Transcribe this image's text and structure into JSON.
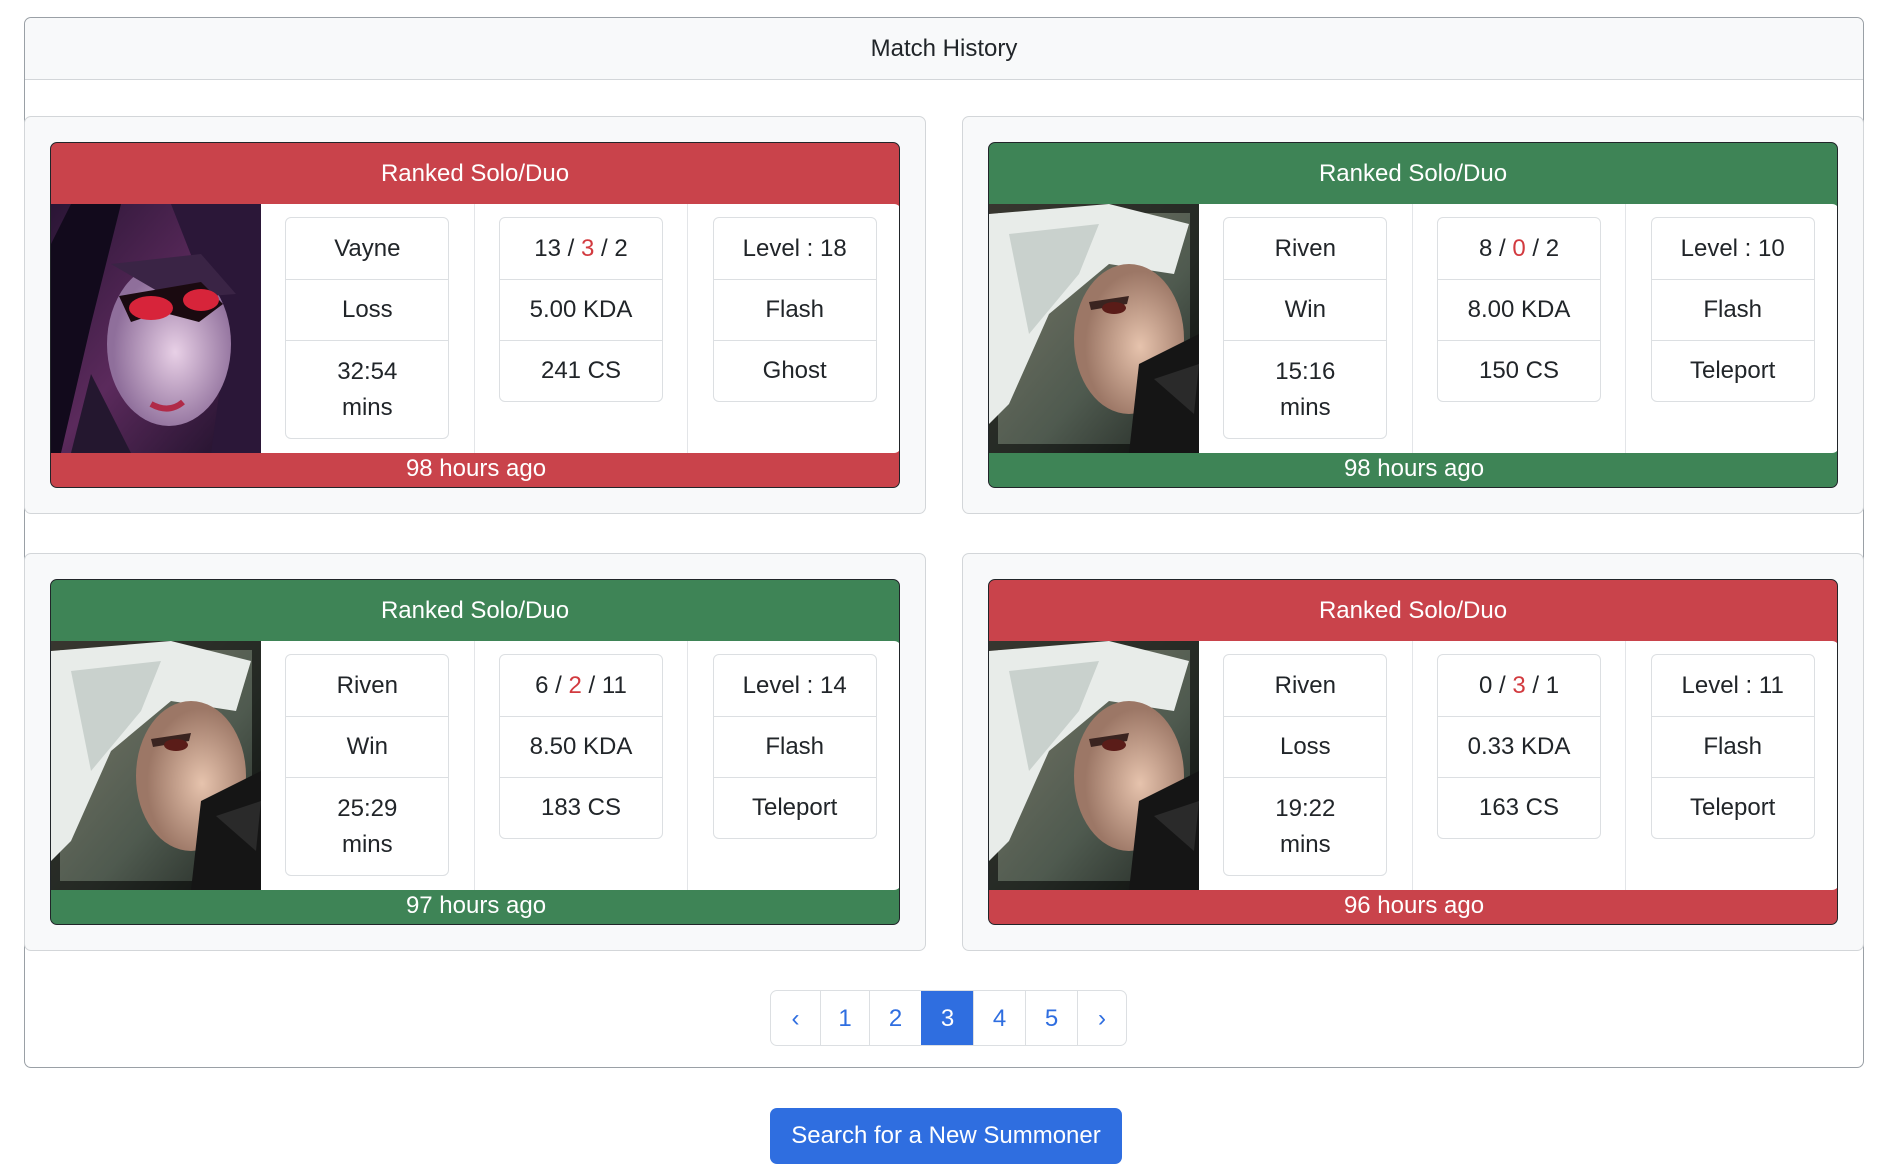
{
  "header": {
    "title": "Match History"
  },
  "matches": [
    {
      "result_class": "loss",
      "queue": "Ranked Solo/Duo",
      "champion": "Vayne",
      "result": "Loss",
      "duration_time": "32:54",
      "duration_unit": "mins",
      "kills": "13",
      "deaths": "3",
      "assists": "2",
      "kda": "5.00 KDA",
      "cs": "241 CS",
      "level": "Level : 18",
      "spell1": "Flash",
      "spell2": "Ghost",
      "time_ago": "98 hours ago",
      "portrait_icon": "vayne-champion-portrait"
    },
    {
      "result_class": "win",
      "queue": "Ranked Solo/Duo",
      "champion": "Riven",
      "result": "Win",
      "duration_time": "15:16",
      "duration_unit": "mins",
      "kills": "8",
      "deaths": "0",
      "assists": "2",
      "kda": "8.00 KDA",
      "cs": "150 CS",
      "level": "Level : 10",
      "spell1": "Flash",
      "spell2": "Teleport",
      "time_ago": "98 hours ago",
      "portrait_icon": "riven-champion-portrait"
    },
    {
      "result_class": "win",
      "queue": "Ranked Solo/Duo",
      "champion": "Riven",
      "result": "Win",
      "duration_time": "25:29",
      "duration_unit": "mins",
      "kills": "6",
      "deaths": "2",
      "assists": "11",
      "kda": "8.50 KDA",
      "cs": "183 CS",
      "level": "Level : 14",
      "spell1": "Flash",
      "spell2": "Teleport",
      "time_ago": "97 hours ago",
      "portrait_icon": "riven-champion-portrait"
    },
    {
      "result_class": "loss",
      "queue": "Ranked Solo/Duo",
      "champion": "Riven",
      "result": "Loss",
      "duration_time": "19:22",
      "duration_unit": "mins",
      "kills": "0",
      "deaths": "3",
      "assists": "1",
      "kda": "0.33 KDA",
      "cs": "163 CS",
      "level": "Level : 11",
      "spell1": "Flash",
      "spell2": "Teleport",
      "time_ago": "96 hours ago",
      "portrait_icon": "riven-champion-portrait"
    }
  ],
  "pagination": {
    "prev": "‹",
    "pages": [
      "1",
      "2",
      "3",
      "4",
      "5"
    ],
    "active_page": "3",
    "next": "›"
  },
  "search_button": "Search for a New Summoner",
  "colors": {
    "loss": "#c9434b",
    "win": "#3e8456",
    "primary": "#2f6ee0",
    "deaths": "#d23a3f"
  }
}
